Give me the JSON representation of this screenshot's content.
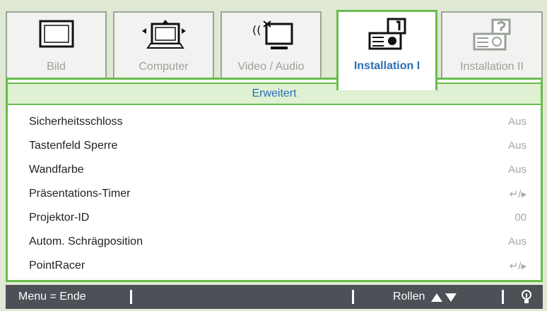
{
  "tabs": [
    {
      "label": "Bild",
      "icon": "picture-icon"
    },
    {
      "label": "Computer",
      "icon": "computer-icon"
    },
    {
      "label": "Video / Audio",
      "icon": "video-audio-icon"
    },
    {
      "label": "Installation I",
      "icon": "projector-icon",
      "active": true
    },
    {
      "label": "Installation II",
      "icon": "projector-settings-icon"
    }
  ],
  "section": {
    "title": "Erweitert"
  },
  "rows": [
    {
      "name": "Sicherheitsschloss",
      "value": "Aus"
    },
    {
      "name": "Tastenfeld Sperre",
      "value": "Aus"
    },
    {
      "name": "Wandfarbe",
      "value": "Aus"
    },
    {
      "name": "Präsentations-Timer",
      "value": "↵/▸"
    },
    {
      "name": "Projektor-ID",
      "value": "00"
    },
    {
      "name": "Autom. Schrägposition",
      "value": "Aus"
    },
    {
      "name": "PointRacer",
      "value": "↵/▸"
    }
  ],
  "footer": {
    "menu_label": "Menu = Ende",
    "scroll_label": "Rollen"
  },
  "colors": {
    "accent_green": "#68bd4c",
    "title_blue": "#2b6fb5",
    "footer_bg": "#4d5056"
  }
}
